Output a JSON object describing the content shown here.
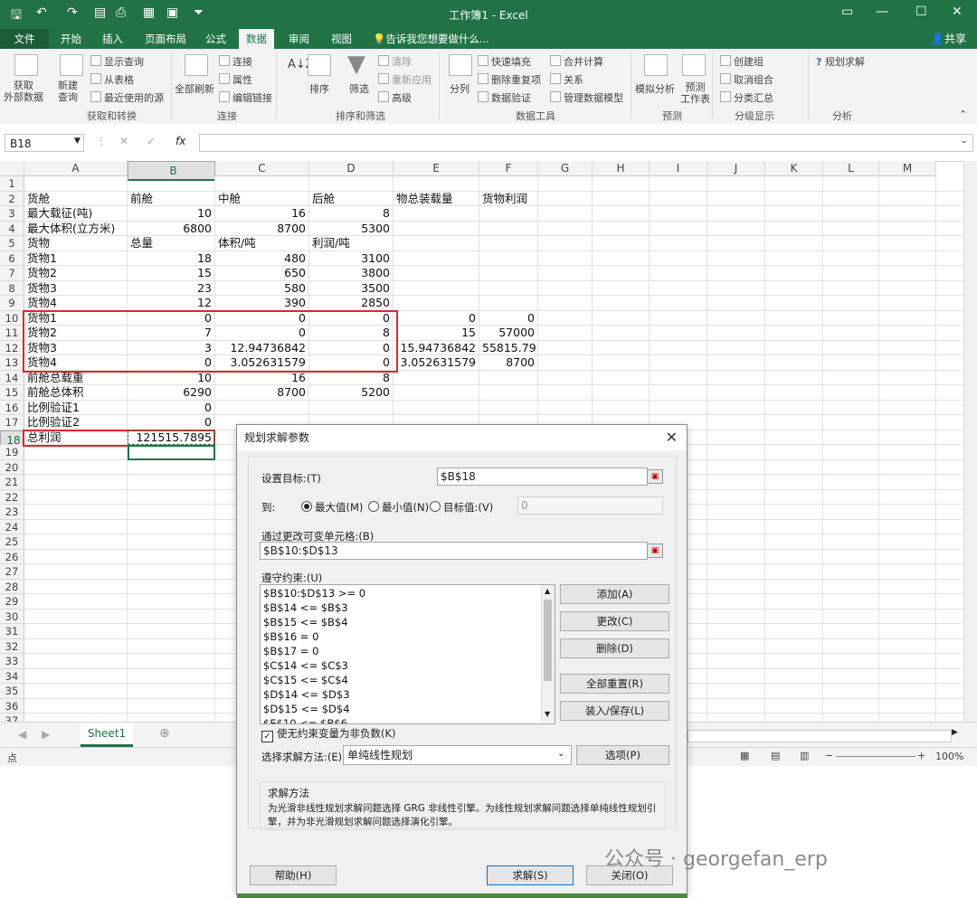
{
  "window": {
    "title": "工作簿1 - Excel",
    "share": "共享"
  },
  "tabs": [
    {
      "label": "文件"
    },
    {
      "label": "开始"
    },
    {
      "label": "插入"
    },
    {
      "label": "页面布局"
    },
    {
      "label": "公式"
    },
    {
      "label": "数据"
    },
    {
      "label": "审阅"
    },
    {
      "label": "视图"
    },
    {
      "label": "告诉我您想要做什么..."
    }
  ],
  "ribbon": {
    "get_external": "获取\n外部数据",
    "new_query": "新建\n查询",
    "show_query": "显示查询",
    "from_table": "从表格",
    "recent_sources": "最近使用的源",
    "group_get": "获取和转换",
    "refresh_all": "全部刷新",
    "connections": "连接",
    "properties": "属性",
    "edit_links": "编辑链接",
    "group_conn": "连接",
    "sort": "排序",
    "filter": "筛选",
    "clear": "清除",
    "reapply": "重新应用",
    "advanced": "高级",
    "group_sort": "排序和筛选",
    "split": "分列",
    "flash_fill": "快速填充",
    "remove_dup": "删除重复项",
    "validation": "数据验证",
    "consolidate": "合并计算",
    "relations": "关系",
    "data_model": "管理数据模型",
    "group_tools": "数据工具",
    "whatif": "模拟分析",
    "forecast": "预测\n工作表",
    "group_forecast": "预测",
    "group_create": "创建组",
    "ungroup": "取消组合",
    "subtotal": "分类汇总",
    "group_outline": "分级显示",
    "solver": "规划求解",
    "group_analysis": "分析"
  },
  "formula_bar": {
    "name_box": "B18",
    "formula": ""
  },
  "columns": [
    "A",
    "B",
    "C",
    "D",
    "E",
    "F",
    "G",
    "H",
    "I",
    "J",
    "K",
    "L",
    "M"
  ],
  "rows": [
    "1",
    "2",
    "3",
    "4",
    "5",
    "6",
    "7",
    "8",
    "9",
    "10",
    "11",
    "12",
    "13",
    "14",
    "15",
    "16",
    "17",
    "18",
    "19",
    "20",
    "21",
    "22",
    "23",
    "24",
    "25",
    "26",
    "27",
    "28",
    "29",
    "30",
    "31",
    "32",
    "33",
    "34",
    "35",
    "36",
    "37"
  ],
  "cells": {
    "A2": "货舱",
    "B2": "前舱",
    "C2": "中舱",
    "D2": "后舱",
    "E2": "物总装载量",
    "F2": "货物利润",
    "A3": "最大载征(吨)",
    "B3": "10",
    "C3": "16",
    "D3": "8",
    "A4": "最大体积(立方米)",
    "B4": "6800",
    "C4": "8700",
    "D4": "5300",
    "A5": "货物",
    "B5": "总量",
    "C5": "体积/吨",
    "D5": "利润/吨",
    "A6": "货物1",
    "B6": "18",
    "C6": "480",
    "D6": "3100",
    "A7": "货物2",
    "B7": "15",
    "C7": "650",
    "D7": "3800",
    "A8": "货物3",
    "B8": "23",
    "C8": "580",
    "D8": "3500",
    "A9": "货物4",
    "B9": "12",
    "C9": "390",
    "D9": "2850",
    "A10": "货物1",
    "B10": "0",
    "C10": "0",
    "D10": "0",
    "E10": "0",
    "F10": "0",
    "A11": "货物2",
    "B11": "7",
    "C11": "0",
    "D11": "8",
    "E11": "15",
    "F11": "57000",
    "A12": "货物3",
    "B12": "3",
    "C12": "12.94736842",
    "D12": "0",
    "E12": "15.94736842",
    "F12": "55815.79",
    "A13": "货物4",
    "B13": "0",
    "C13": "3.052631579",
    "D13": "0",
    "E13": "3.052631579",
    "F13": "8700",
    "A14": "前舱总载重",
    "B14": "10",
    "C14": "16",
    "D14": "8",
    "A15": "前舱总体积",
    "B15": "6290",
    "C15": "8700",
    "D15": "5200",
    "A16": "比例验证1",
    "B16": "0",
    "A17": "比例验证2",
    "B17": "0",
    "A18": "总利润",
    "B18": "121515.7895"
  },
  "sheet_tab": "Sheet1",
  "status": {
    "left": "点",
    "zoom": "100%"
  },
  "dialog": {
    "title": "规划求解参数",
    "set_objective_label": "设置目标:(T)",
    "objective_value": "$B$18",
    "to_label": "到:",
    "opt_max": "最大值(M)",
    "opt_min": "最小值(N)",
    "opt_value": "目标值:(V)",
    "target_value": "0",
    "changing_label": "通过更改可变单元格:(B)",
    "changing_value": "$B$10:$D$13",
    "constraints_label": "遵守约束:(U)",
    "constraints": [
      "$B$10:$D$13 >= 0",
      "$B$14 <= $B$3",
      "$B$15 <= $B$4",
      "$B$16 = 0",
      "$B$17 = 0",
      "$C$14 <= $C$3",
      "$C$15 <= $C$4",
      "$D$14 <= $D$3",
      "$D$15 <= $D$4",
      "$E$10 <= $B$6"
    ],
    "btn_add": "添加(A)",
    "btn_change": "更改(C)",
    "btn_delete": "删除(D)",
    "btn_reset": "全部重置(R)",
    "btn_loadsave": "装入/保存(L)",
    "nonneg_label": "使无约束变量为非负数(K)",
    "method_label": "选择求解方法:(E)",
    "method_value": "单纯线性规划",
    "btn_options": "选项(P)",
    "method_title": "求解方法",
    "method_desc": "为光滑非线性规划求解问题选择 GRG 非线性引擎。为线性规划求解问题选择单纯线性规划引擎，并为非光滑规划求解问题选择演化引擎。",
    "btn_help": "帮助(H)",
    "btn_solve": "求解(S)",
    "btn_close": "关闭(O)"
  },
  "watermark": "公众号 · georgefan_erp"
}
